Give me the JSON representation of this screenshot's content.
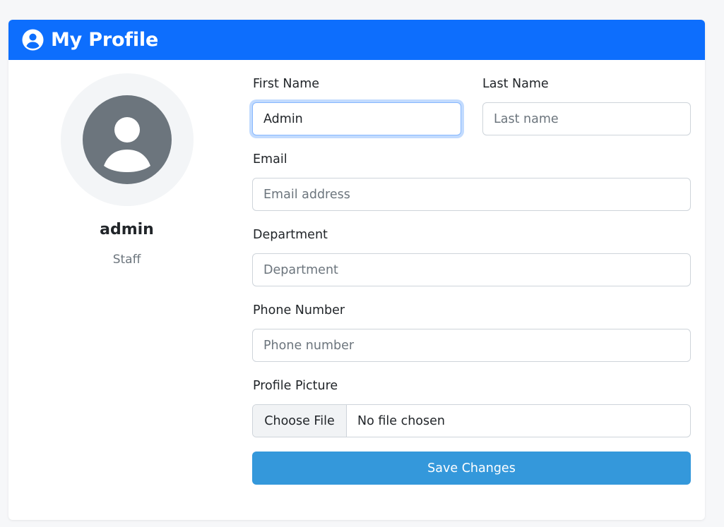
{
  "header": {
    "title": "My Profile",
    "icon": "user-circle-icon",
    "color": "#0d6efd"
  },
  "profile": {
    "username": "admin",
    "role": "Staff",
    "avatar_icon": "user-avatar-icon"
  },
  "form": {
    "first_name": {
      "label": "First Name",
      "value": "Admin"
    },
    "last_name": {
      "label": "Last Name",
      "placeholder": "Last name"
    },
    "email": {
      "label": "Email",
      "placeholder": "Email address"
    },
    "department": {
      "label": "Department",
      "placeholder": "Department"
    },
    "phone": {
      "label": "Phone Number",
      "placeholder": "Phone number"
    },
    "picture": {
      "label": "Profile Picture",
      "button": "Choose File",
      "status": "No file chosen"
    },
    "submit": {
      "label": "Save Changes",
      "color": "#3498db"
    }
  }
}
